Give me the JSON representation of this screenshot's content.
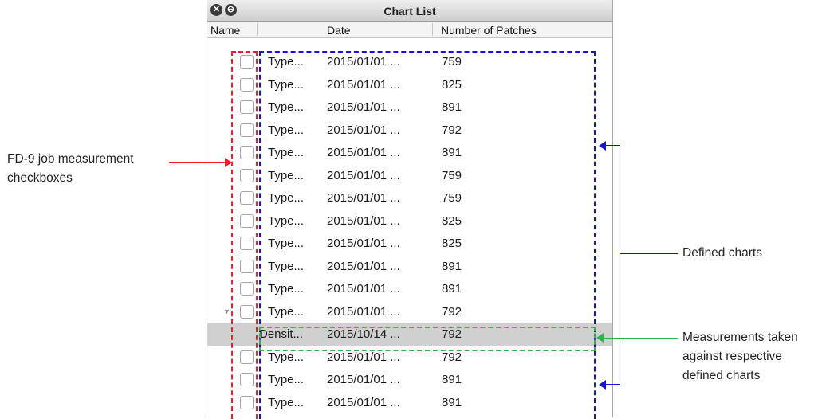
{
  "window": {
    "title": "Chart List",
    "close_glyph": "✕",
    "restore_glyph": "⊖"
  },
  "columns": {
    "name": "Name",
    "date": "Date",
    "patches": "Number of Patches"
  },
  "rows": [
    {
      "name": "Type...",
      "date": "2015/01/01 ...",
      "patches": "759",
      "checkbox": true,
      "selected": false
    },
    {
      "name": "Type...",
      "date": "2015/01/01 ...",
      "patches": "825",
      "checkbox": true,
      "selected": false
    },
    {
      "name": "Type...",
      "date": "2015/01/01 ...",
      "patches": "891",
      "checkbox": true,
      "selected": false
    },
    {
      "name": "Type...",
      "date": "2015/01/01 ...",
      "patches": "792",
      "checkbox": true,
      "selected": false
    },
    {
      "name": "Type...",
      "date": "2015/01/01 ...",
      "patches": "891",
      "checkbox": true,
      "selected": false
    },
    {
      "name": "Type...",
      "date": "2015/01/01 ...",
      "patches": "759",
      "checkbox": true,
      "selected": false
    },
    {
      "name": "Type...",
      "date": "2015/01/01 ...",
      "patches": "759",
      "checkbox": true,
      "selected": false
    },
    {
      "name": "Type...",
      "date": "2015/01/01 ...",
      "patches": "825",
      "checkbox": true,
      "selected": false
    },
    {
      "name": "Type...",
      "date": "2015/01/01 ...",
      "patches": "825",
      "checkbox": true,
      "selected": false
    },
    {
      "name": "Type...",
      "date": "2015/01/01 ...",
      "patches": "891",
      "checkbox": true,
      "selected": false
    },
    {
      "name": "Type...",
      "date": "2015/01/01 ...",
      "patches": "891",
      "checkbox": true,
      "selected": false
    },
    {
      "name": "Type...",
      "date": "2015/01/01 ...",
      "patches": "792",
      "checkbox": true,
      "selected": false,
      "expanded": true
    },
    {
      "name": "Densit...",
      "date": "2015/10/14 ...",
      "patches": "792",
      "checkbox": false,
      "selected": true
    },
    {
      "name": "Type...",
      "date": "2015/01/01 ...",
      "patches": "792",
      "checkbox": true,
      "selected": false
    },
    {
      "name": "Type...",
      "date": "2015/01/01 ...",
      "patches": "891",
      "checkbox": true,
      "selected": false
    },
    {
      "name": "Type...",
      "date": "2015/01/01 ...",
      "patches": "891",
      "checkbox": true,
      "selected": false
    }
  ],
  "annotations": {
    "checkboxes_label": [
      "FD-9 job measurement",
      "checkboxes"
    ],
    "defined_label": "Defined charts",
    "measurements_label": [
      "Measurements taken",
      "against respective",
      "defined charts"
    ]
  },
  "colors": {
    "red": "#e8202a",
    "blue": "#1414d6",
    "green": "#2fb34a",
    "selected_row": "#d0d0d0"
  },
  "icons": {
    "expand_triangle": "▼"
  }
}
